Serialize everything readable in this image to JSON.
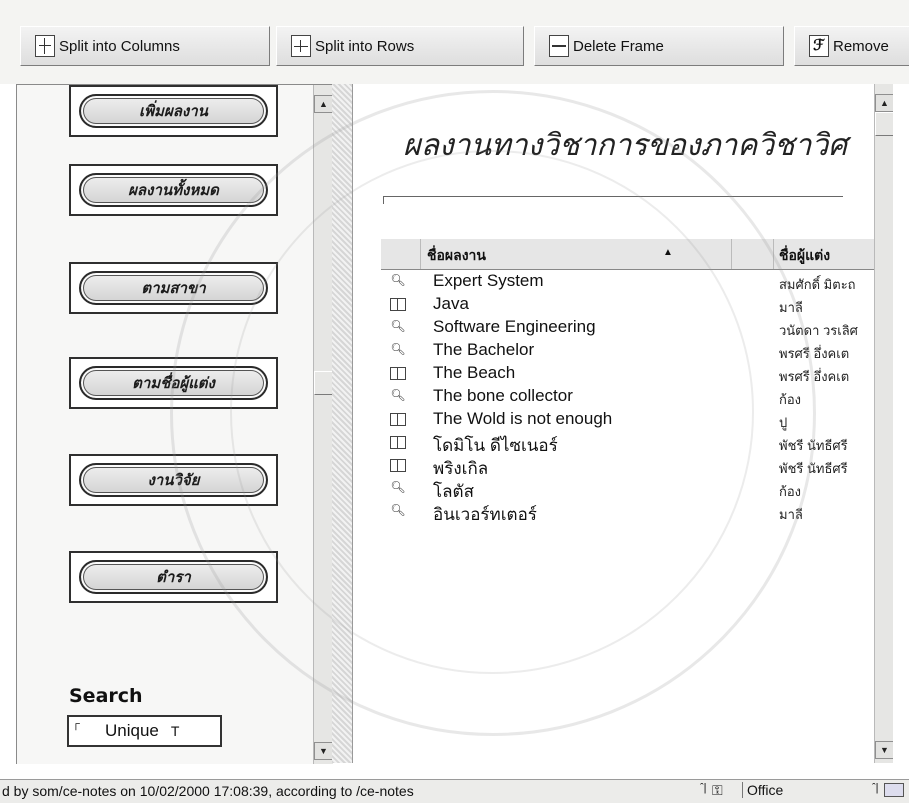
{
  "toolbar": {
    "split_columns": "Split into Columns",
    "split_rows": "Split into Rows",
    "delete_frame": "Delete Frame",
    "remove": "Remove"
  },
  "left_menu": {
    "items": [
      {
        "label": "เพิ่มผลงาน"
      },
      {
        "label": "ผลงานทั้งหมด"
      },
      {
        "label": "ตามสาขา"
      },
      {
        "label": "ตามชื่อผู้แต่ง"
      },
      {
        "label": "งานวิจัย"
      },
      {
        "label": "ตำรา"
      }
    ],
    "search_label": "Search",
    "search_value": "Unique",
    "search_suffix": "T"
  },
  "right": {
    "heading": "ผลงานทางวิชาการของภาควิชาวิศ",
    "table": {
      "col_name": "ชื่อผลงาน",
      "col_author": "ชื่อผู้แต่ง",
      "rows": [
        {
          "icon": "magnifier-icon",
          "name": "Expert System",
          "author": "สมศักดิ์ มิตะถ"
        },
        {
          "icon": "book-icon",
          "name": "Java",
          "author": "มาลี"
        },
        {
          "icon": "magnifier-icon",
          "name": "Software Engineering",
          "author": "วนัตดา วรเลิศ"
        },
        {
          "icon": "magnifier-icon",
          "name": "The Bachelor",
          "author": "พรศรี อึ่งคเต"
        },
        {
          "icon": "book-icon",
          "name": "The Beach",
          "author": "พรศรี อึ่งคเต"
        },
        {
          "icon": "magnifier-icon",
          "name": "The bone collector",
          "author": "ก้อง"
        },
        {
          "icon": "book-icon",
          "name": "The Wold is not enough",
          "author": "ปู"
        },
        {
          "icon": "book-icon",
          "name": "โดมิโน ดีไซเนอร์",
          "author": "พัชรี นัทธีศรี"
        },
        {
          "icon": "book-icon",
          "name": "พริงเกิล",
          "author": "พัชรี นัทธีศรี"
        },
        {
          "icon": "magnifier-icon",
          "name": "โลตัส",
          "author": "ก้อง"
        },
        {
          "icon": "magnifier-icon",
          "name": "อินเวอร์ทเตอร์",
          "author": "มาลี"
        }
      ]
    }
  },
  "statusbar": {
    "text": "d by som/ce-notes on 10/02/2000 17:08:39, according to /ce-notes",
    "zone": "Office"
  }
}
